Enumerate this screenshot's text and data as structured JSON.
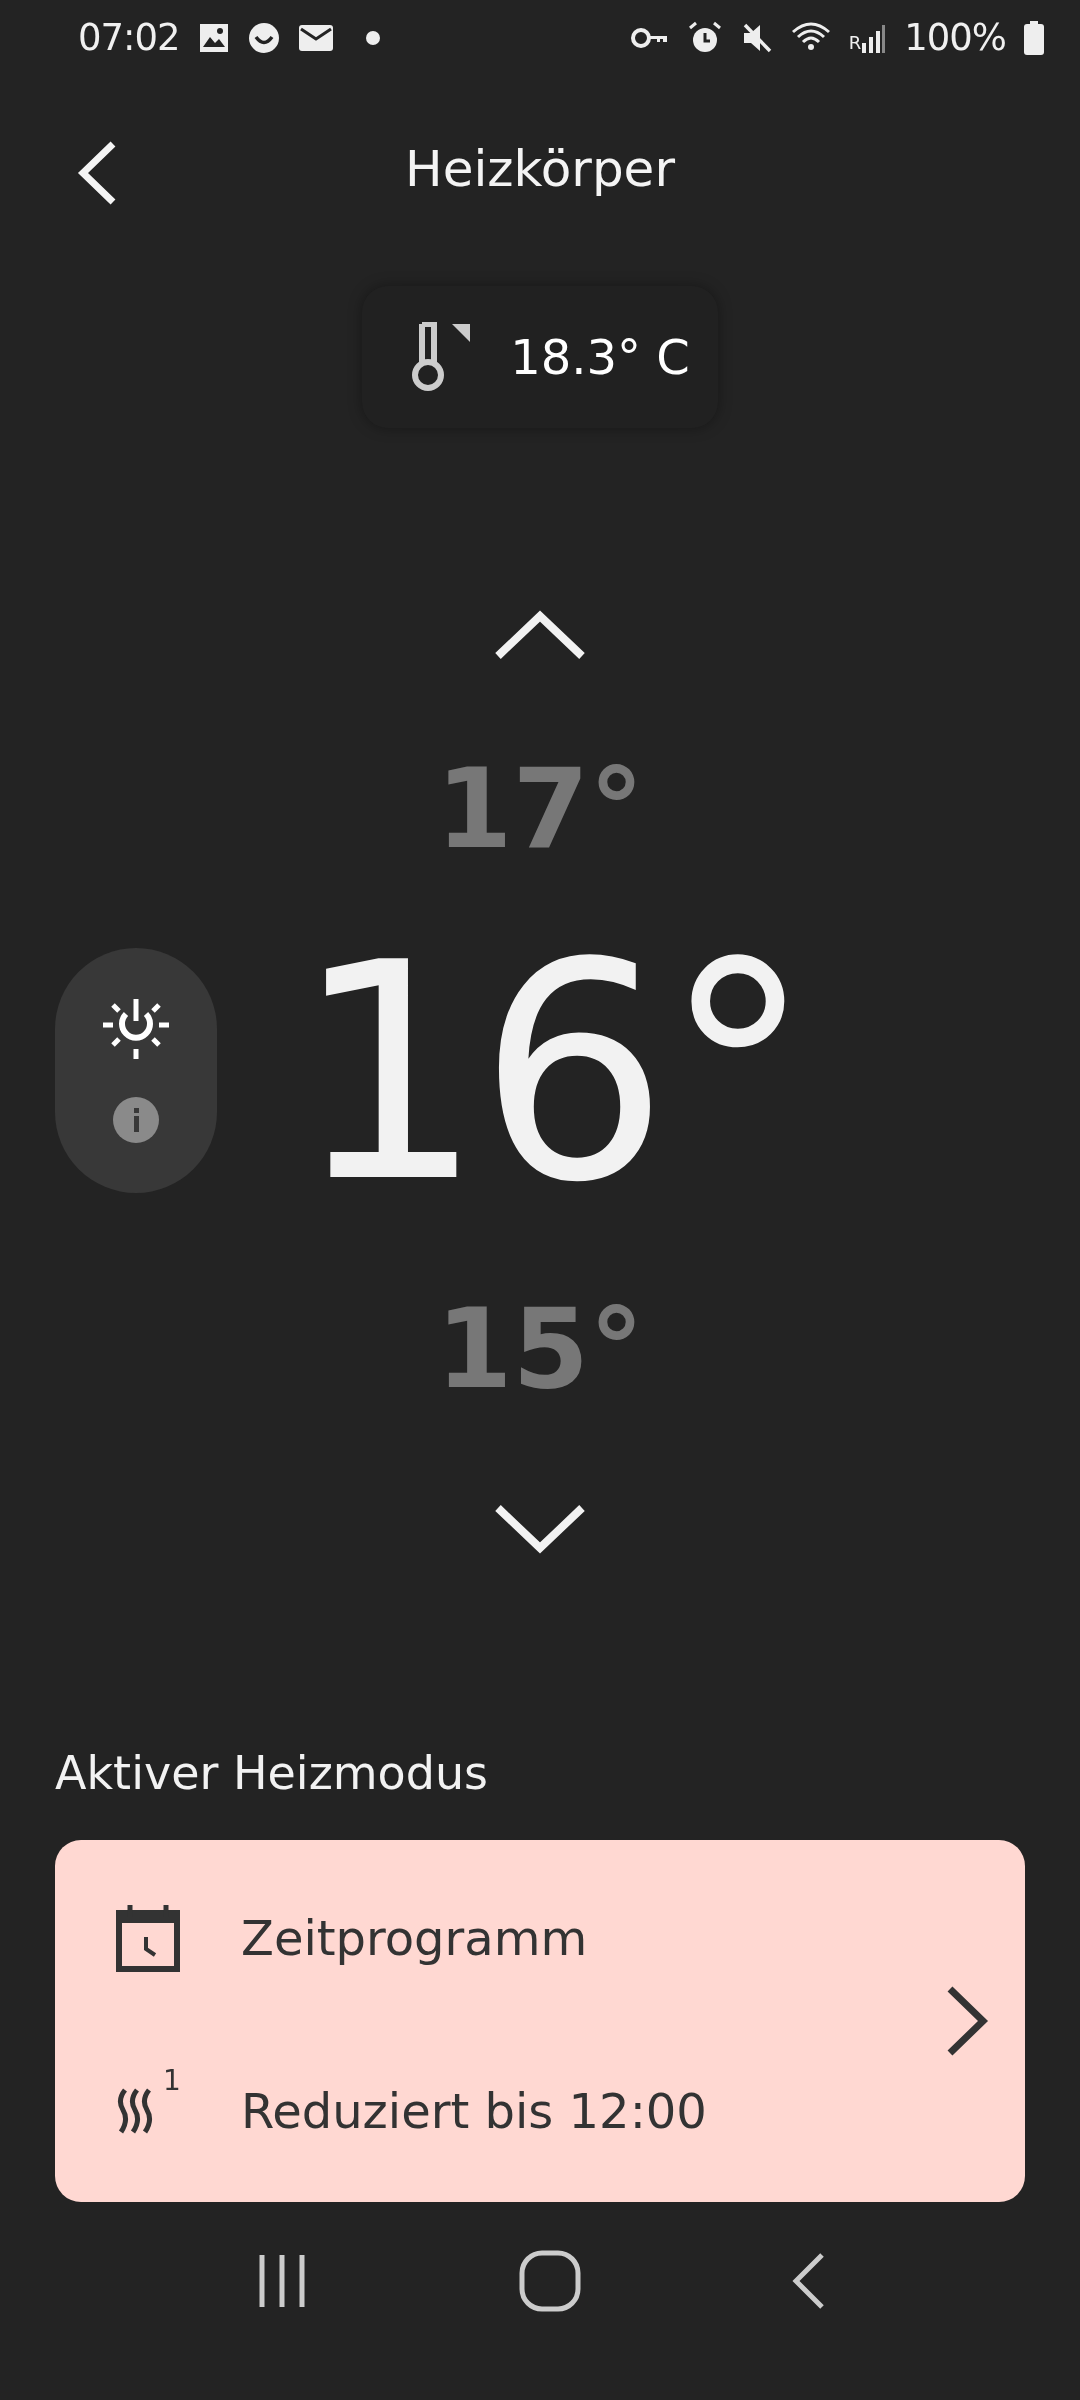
{
  "status_bar": {
    "time": "07:02",
    "roaming": "R",
    "battery": "100%"
  },
  "header": {
    "title": "Heizkörper"
  },
  "room_temperature": {
    "value": "18.3° C"
  },
  "setpoint": {
    "above": "17°",
    "current": "16°",
    "below": "15°"
  },
  "mode_section": {
    "title": "Aktiver Heizmodus",
    "mode": "Zeitprogramm",
    "status": "Reduziert bis 12:00",
    "level_badge": "1"
  }
}
